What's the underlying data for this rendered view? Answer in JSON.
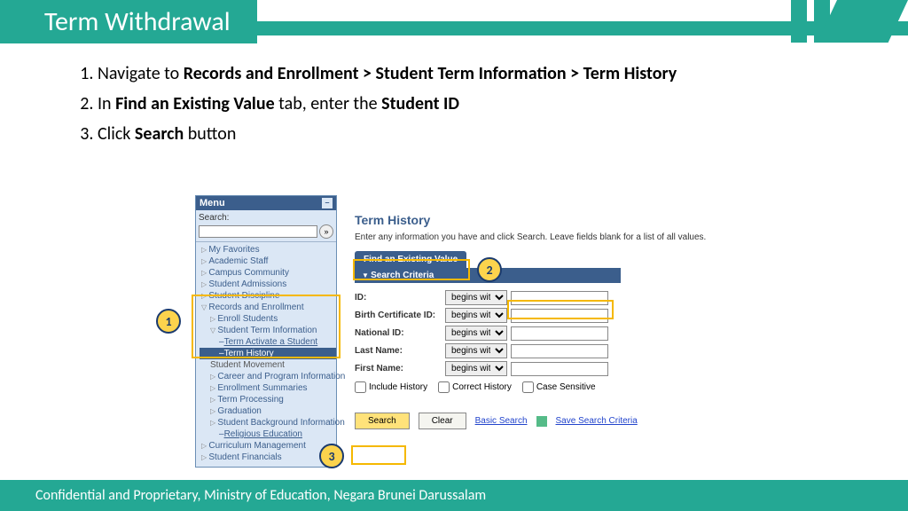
{
  "header": {
    "title": "Term Withdrawal"
  },
  "steps": {
    "s1a": "Navigate to ",
    "s1b": "Records and Enrollment > Student Term Information > Term History",
    "s2a": "In ",
    "s2b": "Find an Existing Value",
    "s2c": " tab, enter the ",
    "s2d": "Student ID",
    "s3a": "Click ",
    "s3b": "Search",
    "s3c": " button"
  },
  "callouts": {
    "c1": "1",
    "c2": "2",
    "c3": "3"
  },
  "menu": {
    "title": "Menu",
    "search_label": "Search:",
    "items": [
      "My Favorites",
      "Academic Staff",
      "Campus Community",
      "Student Admissions",
      "Student Discipline"
    ],
    "records": "Records and Enrollment",
    "sub": {
      "enroll": "Enroll Students",
      "sti": "Student Term Information",
      "term_activate": "Term Activate a Student",
      "term_history": "Term History",
      "student_movement": "Student Movement",
      "career": "Career and Program Information",
      "enroll_sum": "Enrollment Summaries",
      "term_proc": "Term Processing",
      "grad": "Graduation",
      "bg": "Student Background Information",
      "religious": "Religious Education"
    },
    "rest": [
      "Curriculum Management",
      "Student Financials"
    ]
  },
  "main": {
    "title": "Term History",
    "hint": "Enter any information you have and click Search. Leave fields blank for a list of all values.",
    "tab": "Find an Existing Value",
    "criteria": "Search Criteria",
    "fields": {
      "id": "ID:",
      "birth": "Birth Certificate ID:",
      "nat": "National ID:",
      "last": "Last Name:",
      "first": "First Name:"
    },
    "op": "begins with",
    "checks": {
      "inc": "Include History",
      "cor": "Correct History",
      "cs": "Case Sensitive"
    },
    "search": "Search",
    "clear": "Clear",
    "basic": "Basic Search",
    "save": "Save Search Criteria"
  },
  "footer": "Confidential and Proprietary, Ministry of Education, Negara Brunei Darussalam"
}
